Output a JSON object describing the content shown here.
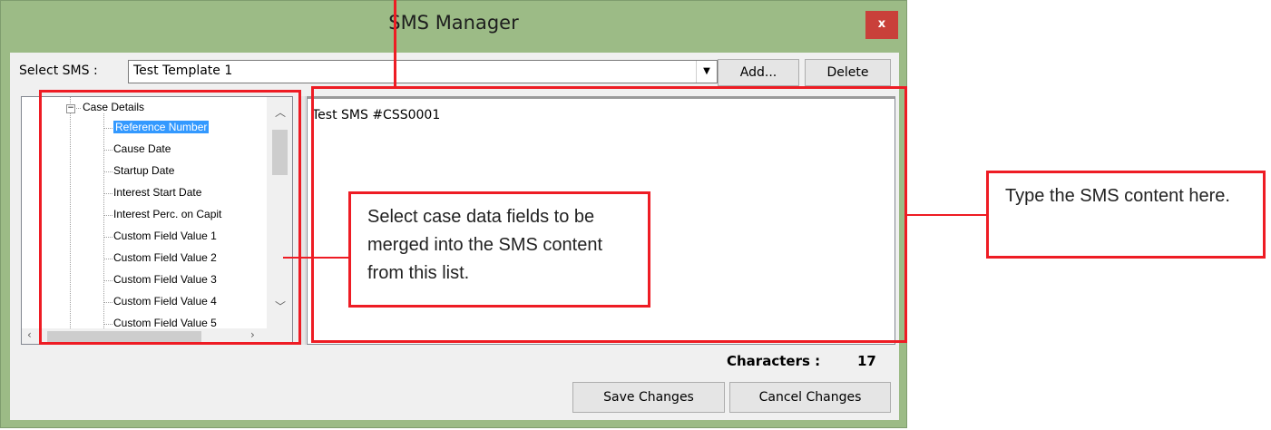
{
  "window": {
    "title": "SMS Manager",
    "close_glyph": "x"
  },
  "toolbar": {
    "select_label": "Select SMS :",
    "selected_template": "Test Template 1",
    "dropdown_glyph": "▼",
    "add_label": "Add...",
    "delete_label": "Delete"
  },
  "tree": {
    "root_label": "Case Details",
    "expander_glyph": "−",
    "items": [
      "Reference Number",
      "Cause Date",
      "Startup Date",
      "Interest Start Date",
      "Interest Perc. on Capit",
      "Custom Field Value 1",
      "Custom Field Value 2",
      "Custom Field Value 3",
      "Custom Field Value 4",
      "Custom Field Value 5"
    ],
    "selected_index": 0
  },
  "editor": {
    "content": "Test SMS #CSS0001"
  },
  "counter": {
    "label": "Characters :",
    "value": "17"
  },
  "buttons": {
    "save_label": "Save Changes",
    "cancel_label": "Cancel Changes"
  },
  "annotations": {
    "fields_callout": "Select case data fields to be merged into the SMS content from this list.",
    "content_callout": "Type the SMS content here."
  },
  "colors": {
    "accent_red": "#ee1c24",
    "window_green": "#9cbb86",
    "selection_blue": "#3399ff",
    "close_red": "#c9403a"
  },
  "icons": {
    "close": "close-icon",
    "dropdown": "chevron-down-icon",
    "scroll_up": "chevron-up-icon",
    "scroll_down": "chevron-down-icon",
    "scroll_left": "chevron-left-icon",
    "scroll_right": "chevron-right-icon",
    "expander": "collapse-icon"
  }
}
